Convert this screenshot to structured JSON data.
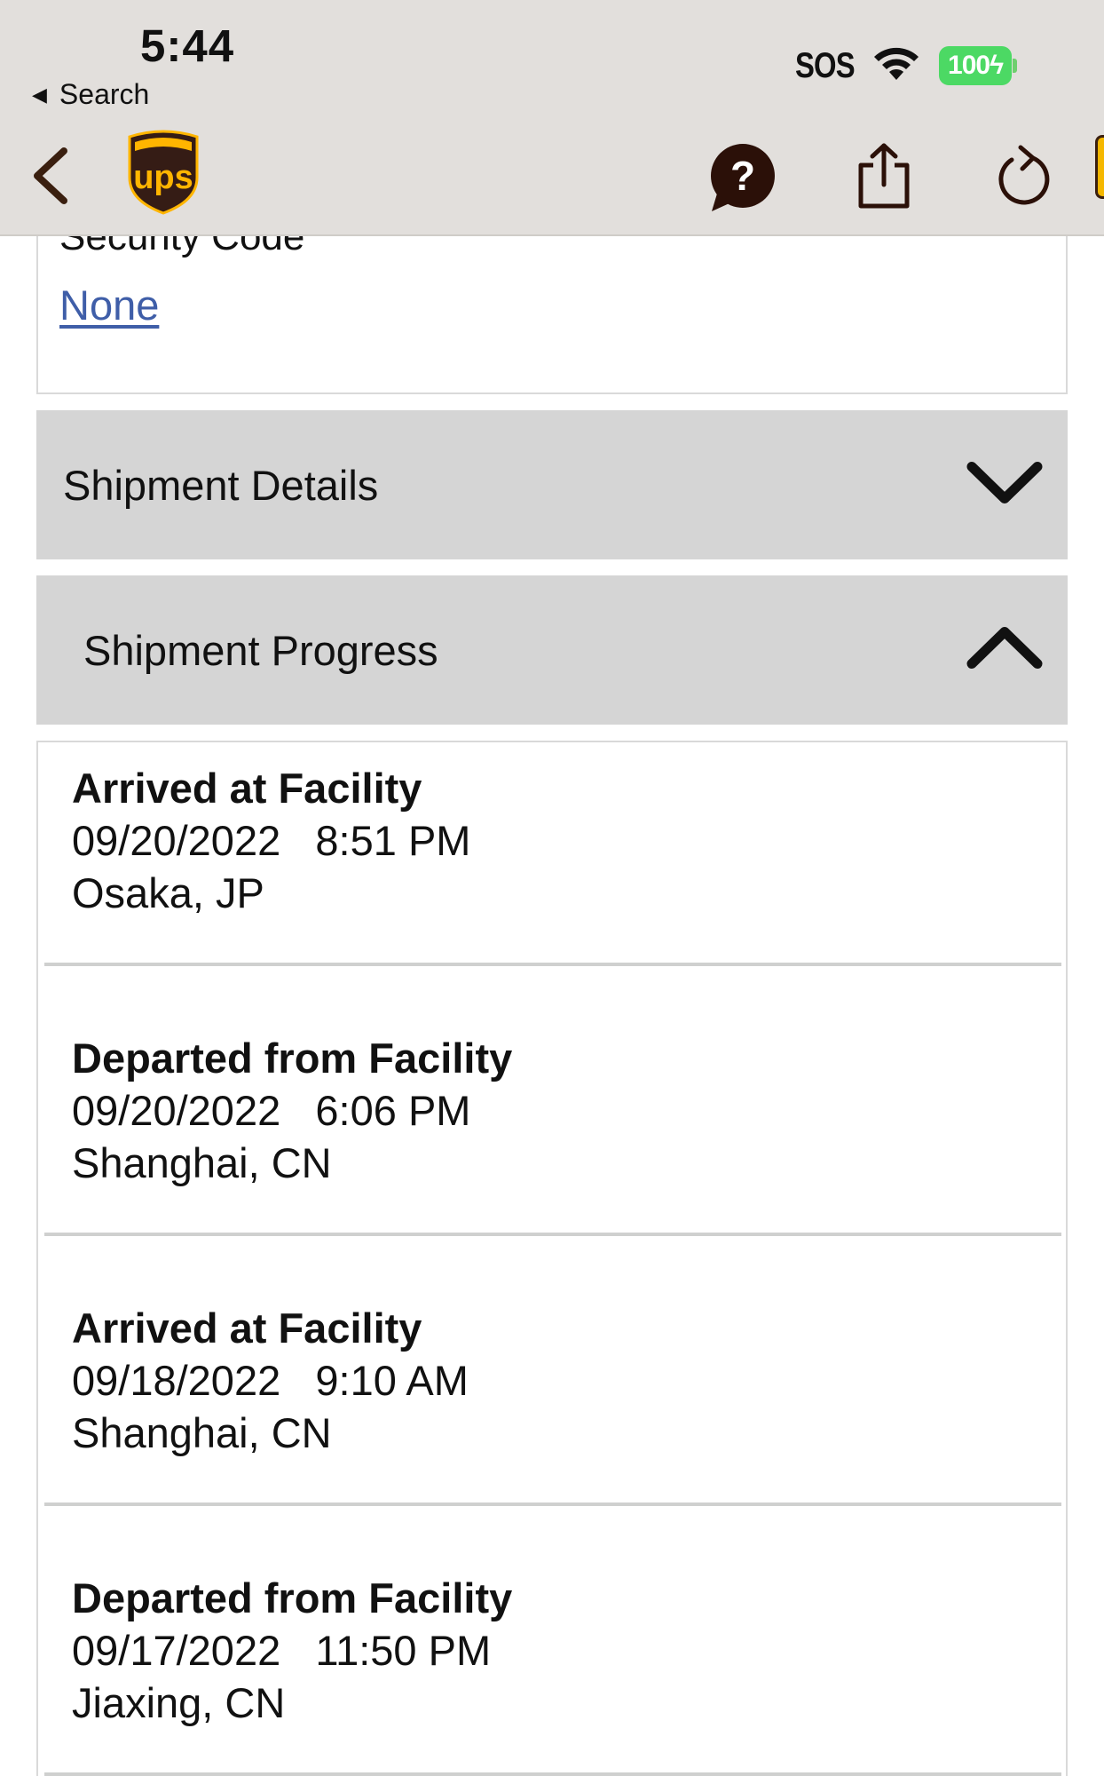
{
  "status_bar": {
    "time": "5:44",
    "back_app_label": "Search",
    "carrier": "SOS",
    "battery": "100"
  },
  "nav": {
    "icons": [
      "back-chevron-icon",
      "ups-logo",
      "help-icon",
      "share-icon",
      "refresh-icon"
    ],
    "brand_colors": {
      "brown": "#351c15",
      "gold": "#ffb500"
    },
    "logo_text": "ups"
  },
  "security": {
    "label": "Security Code",
    "value": "None"
  },
  "sections": {
    "details_title": "Shipment Details",
    "progress_title": "Shipment Progress"
  },
  "events": [
    {
      "status": "Arrived at Facility",
      "date": "09/20/2022",
      "time": "8:51 PM",
      "location": "Osaka, JP"
    },
    {
      "status": "Departed from Facility",
      "date": "09/20/2022",
      "time": "6:06 PM",
      "location": "Shanghai, CN"
    },
    {
      "status": "Arrived at Facility",
      "date": "09/18/2022",
      "time": "9:10 AM",
      "location": "Shanghai, CN"
    },
    {
      "status": "Departed from Facility",
      "date": "09/17/2022",
      "time": "11:50 PM",
      "location": "Jiaxing, CN"
    }
  ]
}
